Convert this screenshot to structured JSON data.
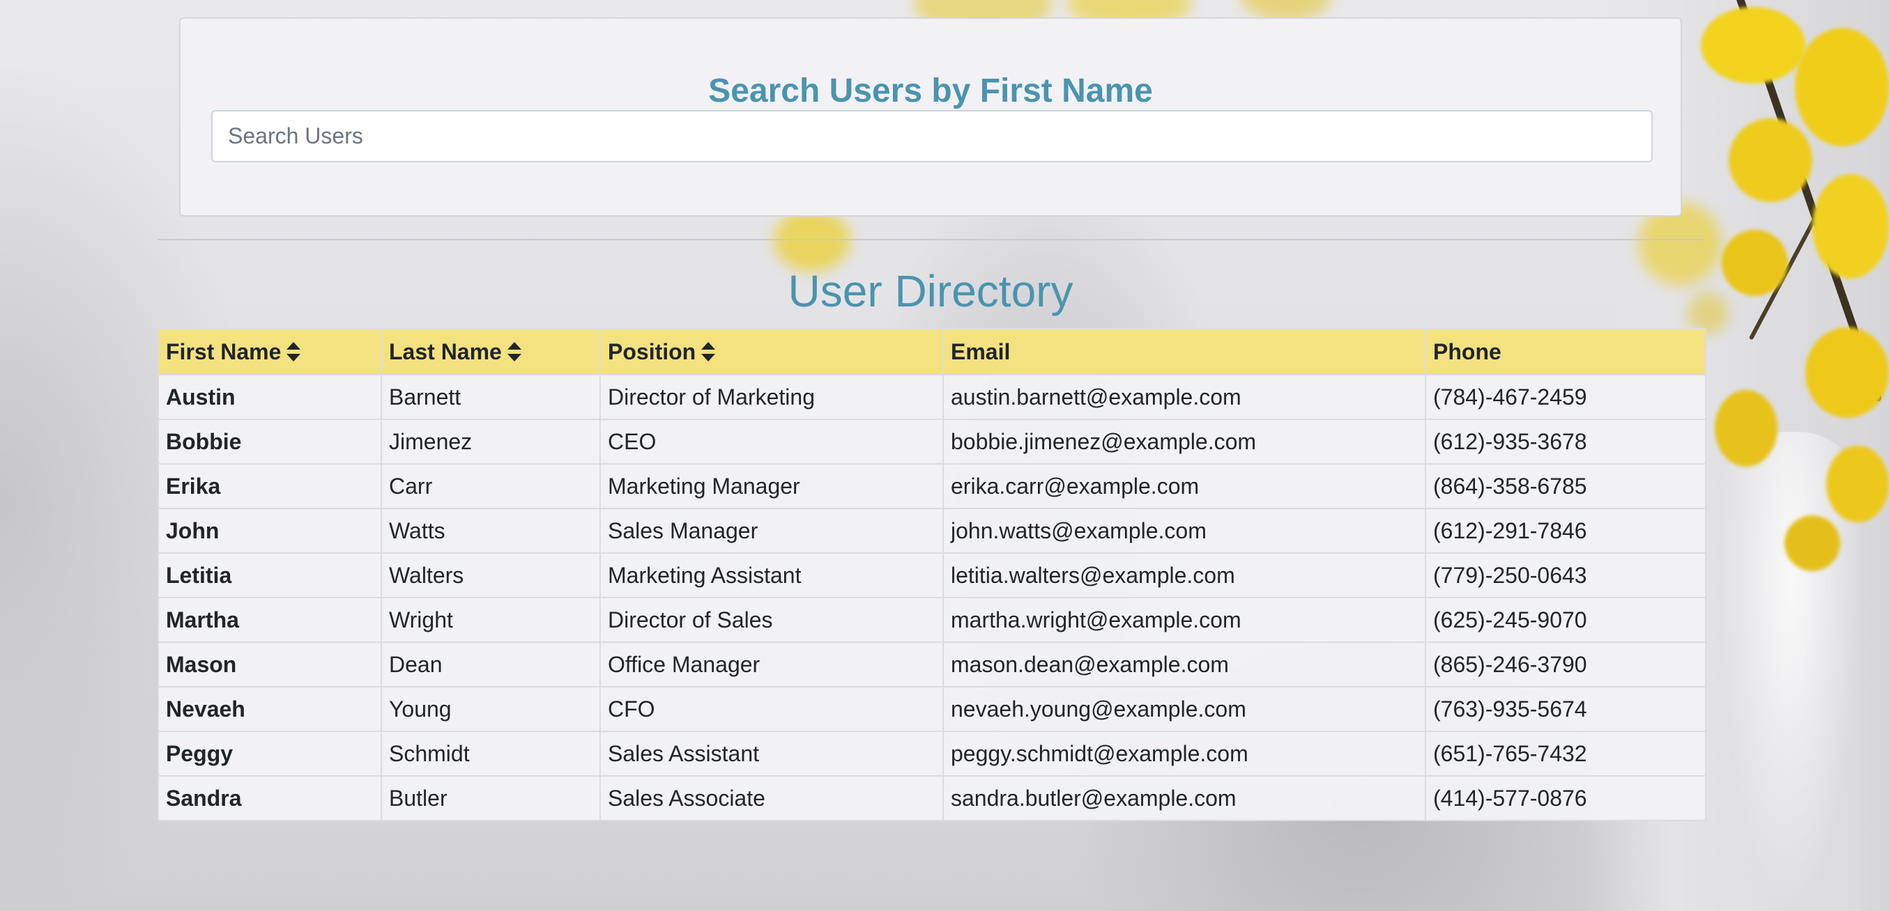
{
  "search": {
    "title": "Search Users by First Name",
    "placeholder": "Search Users",
    "value": ""
  },
  "directory": {
    "title": "User Directory",
    "columns": [
      {
        "label": "First Name",
        "sortable": true
      },
      {
        "label": "Last Name",
        "sortable": true
      },
      {
        "label": "Position",
        "sortable": true
      },
      {
        "label": "Email",
        "sortable": false
      },
      {
        "label": "Phone",
        "sortable": false
      }
    ],
    "rows": [
      {
        "first": "Austin",
        "last": "Barnett",
        "position": "Director of Marketing",
        "email": "austin.barnett@example.com",
        "phone": "(784)-467-2459"
      },
      {
        "first": "Bobbie",
        "last": "Jimenez",
        "position": "CEO",
        "email": "bobbie.jimenez@example.com",
        "phone": "(612)-935-3678"
      },
      {
        "first": "Erika",
        "last": "Carr",
        "position": "Marketing Manager",
        "email": "erika.carr@example.com",
        "phone": "(864)-358-6785"
      },
      {
        "first": "John",
        "last": "Watts",
        "position": "Sales Manager",
        "email": "john.watts@example.com",
        "phone": "(612)-291-7846"
      },
      {
        "first": "Letitia",
        "last": "Walters",
        "position": "Marketing Assistant",
        "email": "letitia.walters@example.com",
        "phone": "(779)-250-0643"
      },
      {
        "first": "Martha",
        "last": "Wright",
        "position": "Director of Sales",
        "email": "martha.wright@example.com",
        "phone": "(625)-245-9070"
      },
      {
        "first": "Mason",
        "last": "Dean",
        "position": "Office Manager",
        "email": "mason.dean@example.com",
        "phone": "(865)-246-3790"
      },
      {
        "first": "Nevaeh",
        "last": "Young",
        "position": "CFO",
        "email": "nevaeh.young@example.com",
        "phone": "(763)-935-5674"
      },
      {
        "first": "Peggy",
        "last": "Schmidt",
        "position": "Sales Assistant",
        "email": "peggy.schmidt@example.com",
        "phone": "(651)-765-7432"
      },
      {
        "first": "Sandra",
        "last": "Butler",
        "position": "Sales Associate",
        "email": "sandra.butler@example.com",
        "phone": "(414)-577-0876"
      }
    ]
  },
  "icons": {
    "sort": "sort-icon"
  },
  "colors": {
    "accent": "#4b94ad",
    "header_background": "#f4e17f",
    "card_background": "#f3f3f6"
  }
}
